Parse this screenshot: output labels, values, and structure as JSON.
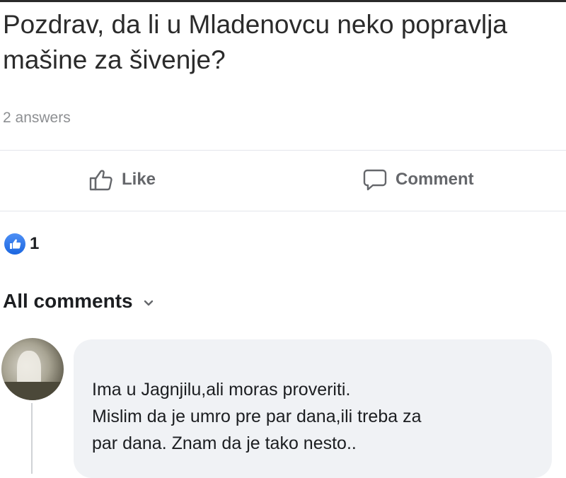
{
  "post": {
    "title": "Pozdrav, da li u Mladenovcu neko popravlja mašine za šivenje?",
    "answers": "2 answers"
  },
  "actions": {
    "like_label": "Like",
    "comment_label": "Comment"
  },
  "reactions": {
    "count": "1",
    "icon": "thumbs-up-icon"
  },
  "comments_filter": {
    "label": "All comments",
    "icon": "chevron-down-icon"
  },
  "comment": {
    "text": "Ima u Jagnjilu,ali moras proveriti.\nMislim da je umro pre par dana,ili treba za\npar dana. Znam da je tako nesto.."
  },
  "colors": {
    "accent": "#1b66e0",
    "bubble": "#f0f2f5",
    "muted": "#65676b"
  }
}
